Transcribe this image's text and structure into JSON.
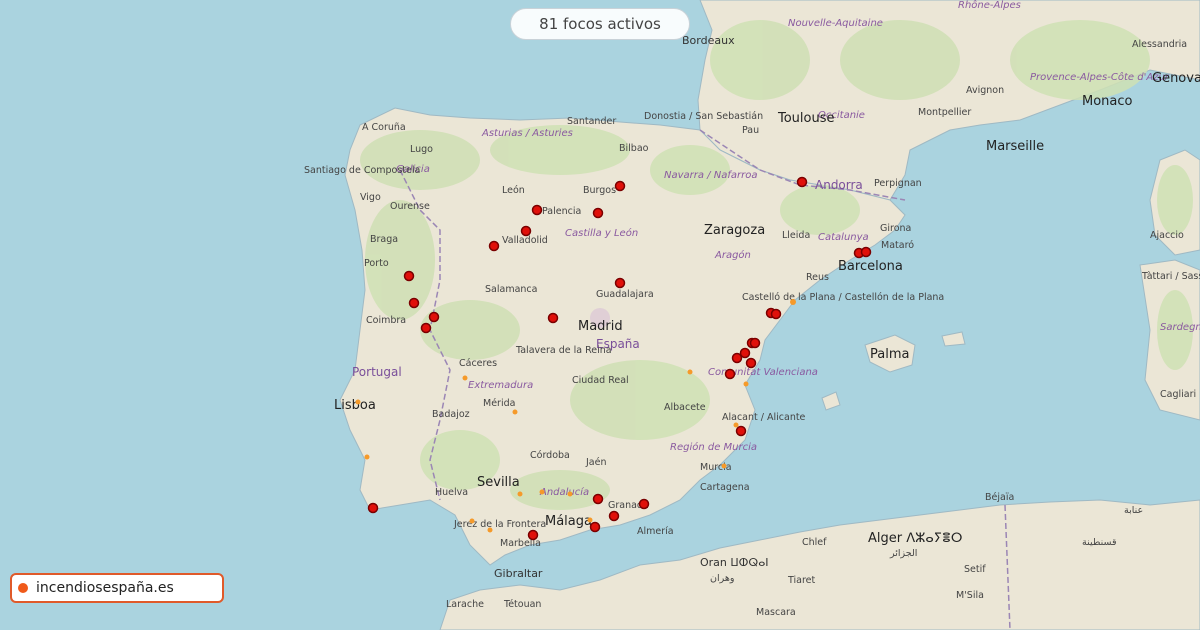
{
  "header": {
    "active_fires_label": "81 focos activos"
  },
  "brand": {
    "name": "incendiosespaña.es",
    "color": "#f05a1a"
  },
  "colors": {
    "sea": "#aad3df",
    "land": "#ebe6d6",
    "forest": "#cfe0b4",
    "fire_marker": "#e0100a",
    "hotspot": "#f59a2a",
    "border": "#9b86b5"
  },
  "map": {
    "countries": [
      {
        "name": "España"
      },
      {
        "name": "Portugal"
      },
      {
        "name": "Andorra"
      }
    ],
    "cities": [
      {
        "name": "Bordeaux"
      },
      {
        "name": "Toulouse"
      },
      {
        "name": "Montpellier"
      },
      {
        "name": "Marseille"
      },
      {
        "name": "Avignon"
      },
      {
        "name": "Monaco"
      },
      {
        "name": "Genova"
      },
      {
        "name": "Alessandria"
      },
      {
        "name": "Pau"
      },
      {
        "name": "Perpignan"
      },
      {
        "name": "A Coruña"
      },
      {
        "name": "Santiago de Compostela"
      },
      {
        "name": "Lugo"
      },
      {
        "name": "Vigo"
      },
      {
        "name": "Ourense"
      },
      {
        "name": "Braga"
      },
      {
        "name": "Porto"
      },
      {
        "name": "Coimbra"
      },
      {
        "name": "Lisboa"
      },
      {
        "name": "Santander"
      },
      {
        "name": "Donostia / San Sebastián"
      },
      {
        "name": "Bilbao"
      },
      {
        "name": "León"
      },
      {
        "name": "Burgos"
      },
      {
        "name": "Palencia"
      },
      {
        "name": "Valladolid"
      },
      {
        "name": "Salamanca"
      },
      {
        "name": "Guadalajara"
      },
      {
        "name": "Madrid"
      },
      {
        "name": "Zaragoza"
      },
      {
        "name": "Lleida"
      },
      {
        "name": "Girona"
      },
      {
        "name": "Mataró"
      },
      {
        "name": "Barcelona"
      },
      {
        "name": "Reus"
      },
      {
        "name": "Castelló de la Plana / Castellón de la Plana"
      },
      {
        "name": "Palma"
      },
      {
        "name": "Talavera de la Reina"
      },
      {
        "name": "Cáceres"
      },
      {
        "name": "Badajoz"
      },
      {
        "name": "Mérida"
      },
      {
        "name": "Ciudad Real"
      },
      {
        "name": "Albacete"
      },
      {
        "name": "Alacant / Alicante"
      },
      {
        "name": "Córdoba"
      },
      {
        "name": "Jaén"
      },
      {
        "name": "Murcia"
      },
      {
        "name": "Cartagena"
      },
      {
        "name": "Sevilla"
      },
      {
        "name": "Huelva"
      },
      {
        "name": "Jerez de la Frontera"
      },
      {
        "name": "Granada"
      },
      {
        "name": "Málaga"
      },
      {
        "name": "Almería"
      },
      {
        "name": "Marbella"
      },
      {
        "name": "Gibraltar"
      },
      {
        "name": "Larache"
      },
      {
        "name": "Tétouan"
      },
      {
        "name": "Oran ⵡⵀⵕⴰⵏ"
      },
      {
        "name": "وهران"
      },
      {
        "name": "Chlef"
      },
      {
        "name": "Alger ⴷⵣⴰⵢⴻⵔ"
      },
      {
        "name": "الجزائر"
      },
      {
        "name": "Tiaret"
      },
      {
        "name": "Béjaïa"
      },
      {
        "name": "Setif"
      },
      {
        "name": "قسنطينة"
      },
      {
        "name": "عنابة"
      },
      {
        "name": "Mascara"
      },
      {
        "name": "M'Sila"
      },
      {
        "name": "Ajaccio"
      },
      {
        "name": "Tàttari / Sassari"
      },
      {
        "name": "Cagliari"
      }
    ],
    "regions": [
      {
        "name": "Nouvelle-Aquitaine"
      },
      {
        "name": "Occitanie"
      },
      {
        "name": "Provence-Alpes-Côte d'Azur"
      },
      {
        "name": "Rhône-Alpes"
      },
      {
        "name": "Asturias / Asturies"
      },
      {
        "name": "Galicia"
      },
      {
        "name": "Navarra / Nafarroa"
      },
      {
        "name": "Castilla y León"
      },
      {
        "name": "Aragón"
      },
      {
        "name": "Catalunya"
      },
      {
        "name": "Comunitat Valenciana"
      },
      {
        "name": "Extremadura"
      },
      {
        "name": "Región de Murcia"
      },
      {
        "name": "Andalucía"
      },
      {
        "name": "Sardegna"
      }
    ]
  }
}
